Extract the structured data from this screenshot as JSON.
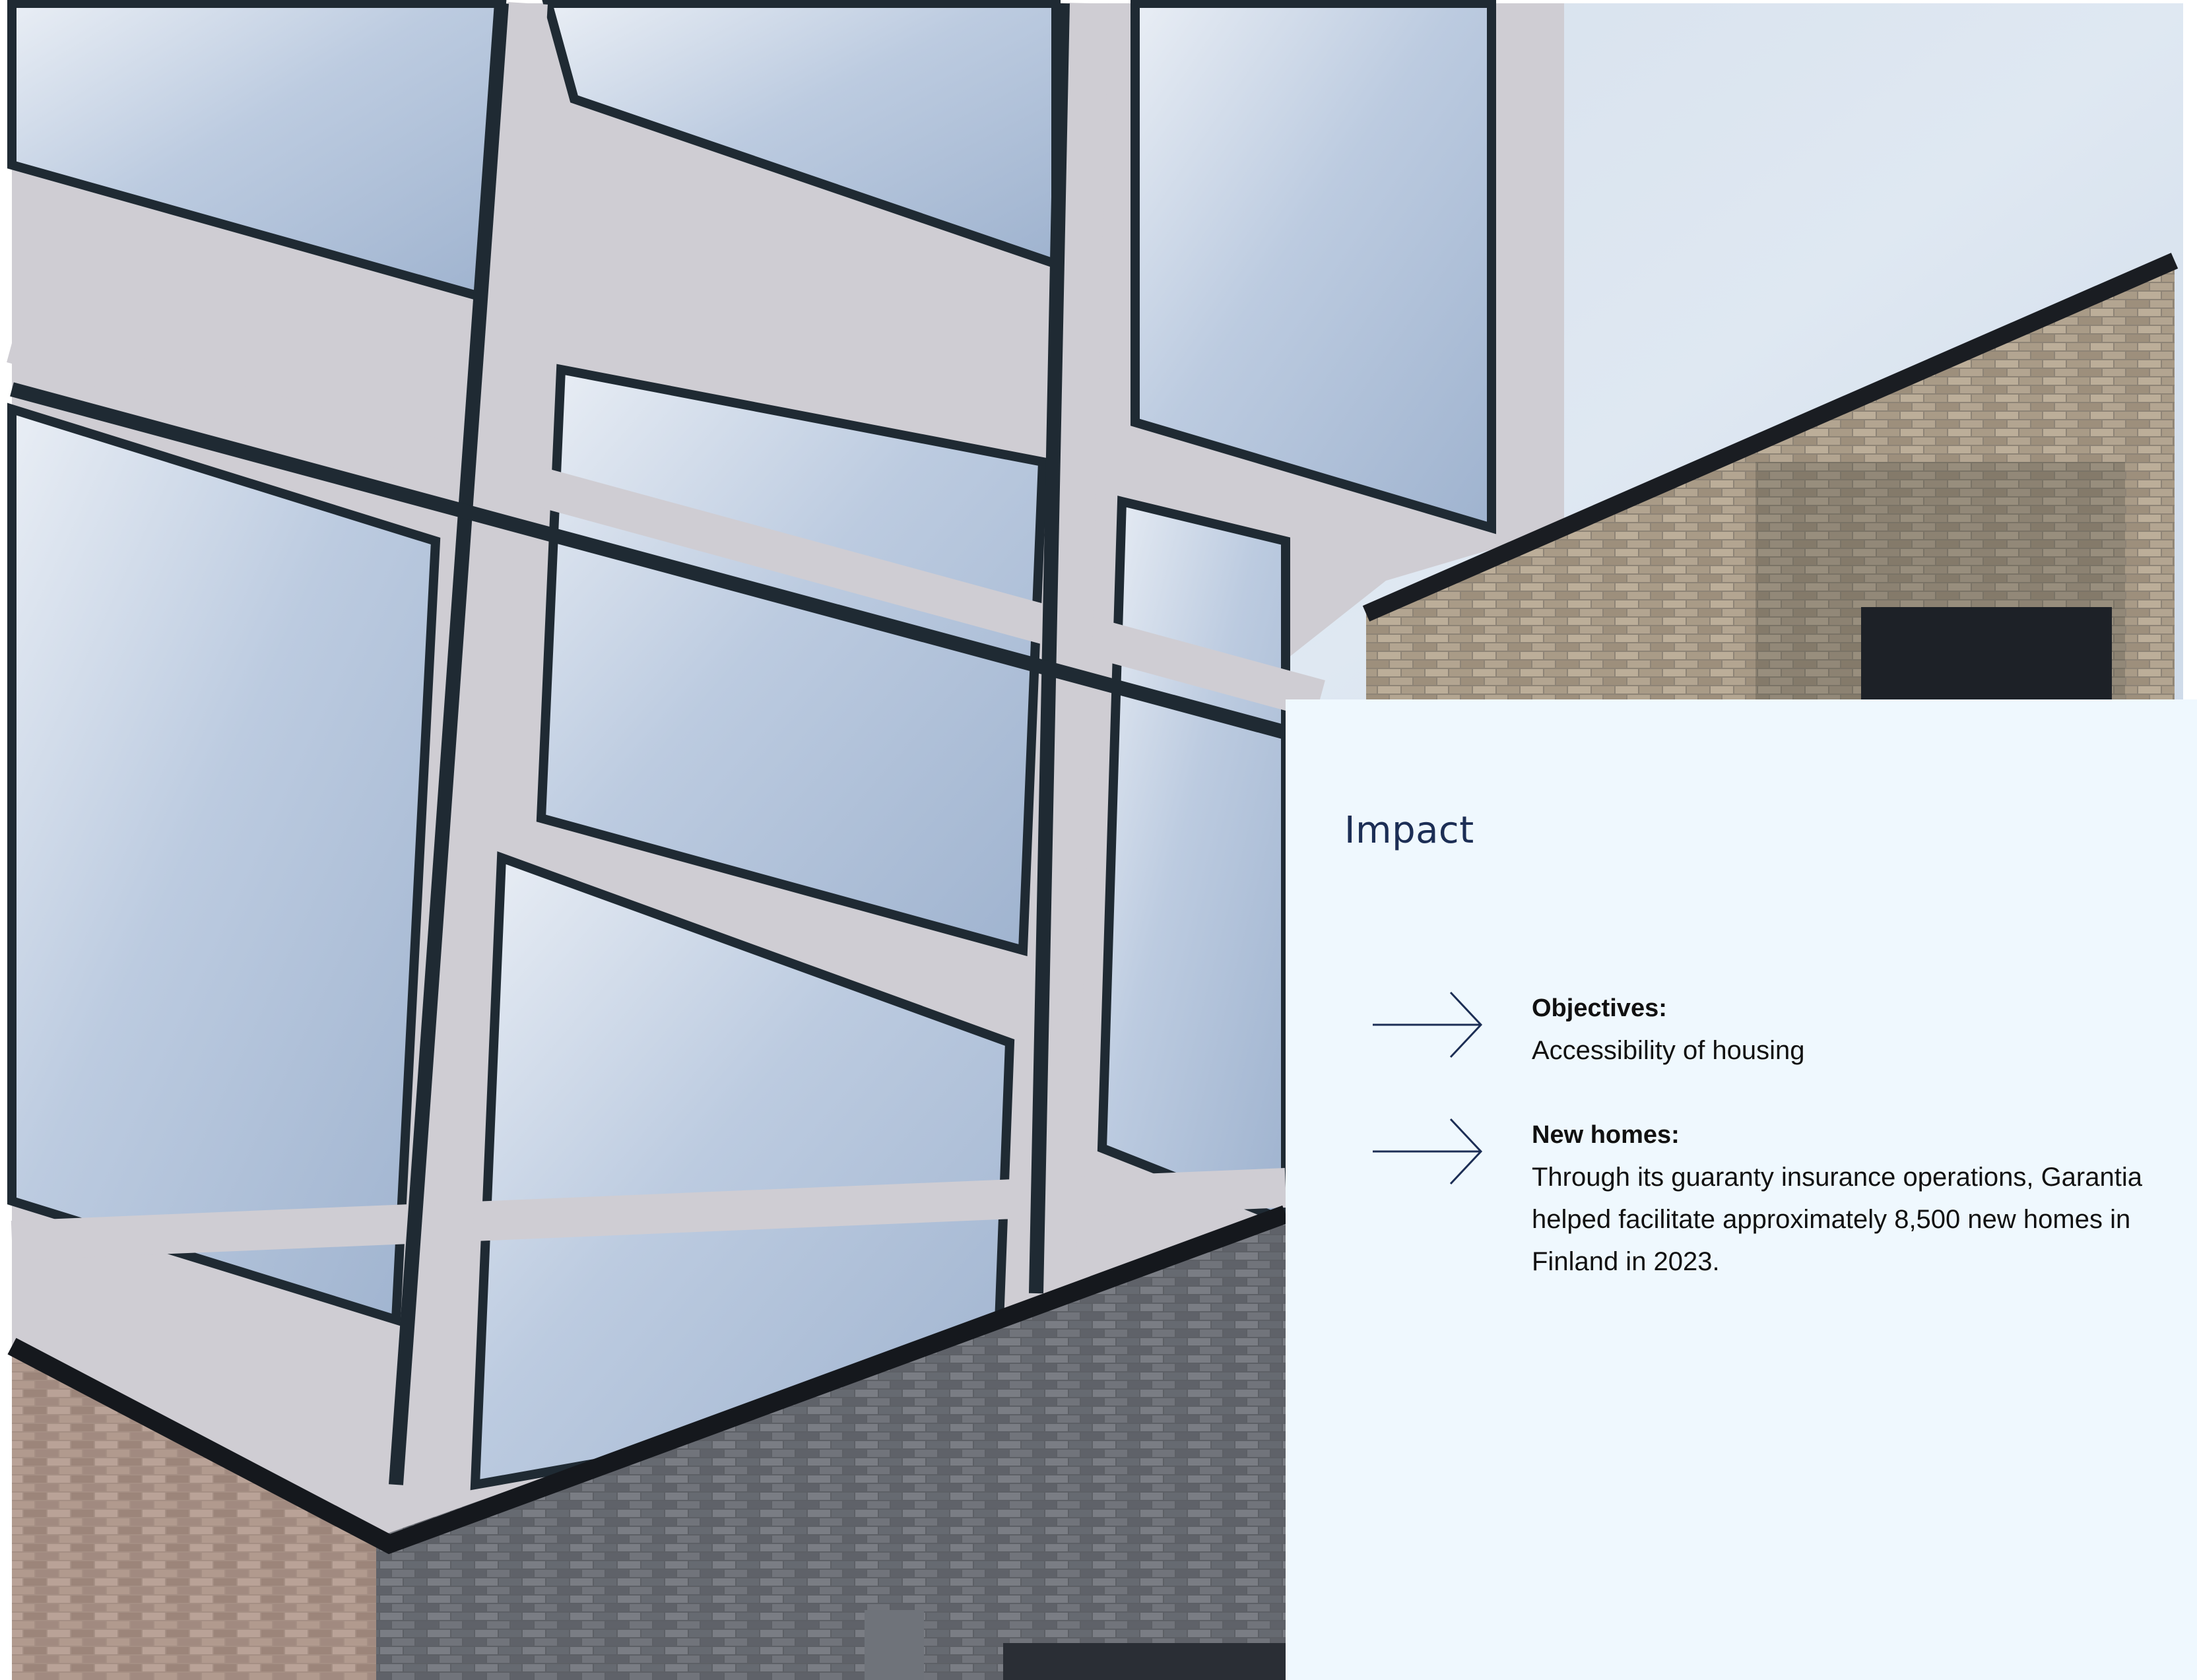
{
  "page": {
    "heading": "Impact",
    "items": [
      {
        "label": "Objectives:",
        "text": "Accessibility of housing"
      },
      {
        "label": "New homes:",
        "text": "Through its guaranty insurance operations, Garantia helped facilitate approximately 8,500 new homes in Finland in 2023."
      }
    ]
  },
  "colors": {
    "panel_background": "#eff8fe",
    "heading": "#1c2e55",
    "arrow": "#1c2e55",
    "body_text": "#111111"
  },
  "icons": [
    "arrow-right-icon"
  ]
}
